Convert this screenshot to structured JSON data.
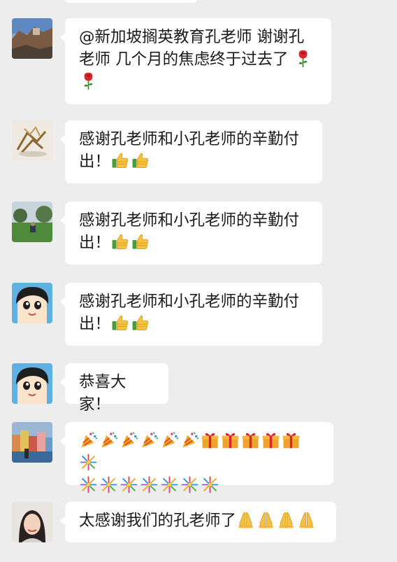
{
  "messages": [
    {
      "id": "m1",
      "avatar": "landscape-coast-avatar",
      "lines": [
        "@新加坡搁英教育孔老师  谢谢孔",
        "老师 几个月的焦虑终于过去了"
      ],
      "emojis_inline": [
        "rose-emoji"
      ],
      "emojis_line3": [
        "rose-emoji"
      ]
    },
    {
      "id": "m2",
      "avatar": "sculpture-avatar",
      "lines": [
        "感谢孔老师和小孔老师的辛勤付",
        "出！"
      ],
      "emojis": [
        "thumbs-up-emoji",
        "thumbs-up-emoji"
      ]
    },
    {
      "id": "m3",
      "avatar": "park-scene-avatar",
      "lines": [
        "感谢孔老师和小孔老师的辛勤付",
        "出！"
      ],
      "emojis": [
        "thumbs-up-emoji",
        "thumbs-up-emoji"
      ]
    },
    {
      "id": "m4",
      "avatar": "cartoon-face-avatar",
      "lines": [
        "感谢孔老师和小孔老师的辛勤付",
        "出！"
      ],
      "emojis": [
        "thumbs-up-emoji",
        "thumbs-up-emoji"
      ]
    },
    {
      "id": "m5",
      "avatar": "cartoon-face-avatar",
      "lines": [
        "恭喜大家！"
      ]
    },
    {
      "id": "m6",
      "avatar": "colorful-town-avatar",
      "emojis_line1": [
        "party-popper-emoji",
        "party-popper-emoji",
        "party-popper-emoji",
        "party-popper-emoji",
        "party-popper-emoji",
        "party-popper-emoji",
        "gift-emoji",
        "gift-emoji",
        "gift-emoji",
        "gift-emoji",
        "gift-emoji",
        "fireworks-emoji"
      ],
      "emojis_line2": [
        "fireworks-emoji",
        "fireworks-emoji",
        "fireworks-emoji",
        "fireworks-emoji",
        "fireworks-emoji",
        "fireworks-emoji",
        "fireworks-emoji"
      ]
    },
    {
      "id": "m7",
      "avatar": "woman-portrait-avatar",
      "lines": [
        "太感谢我们的孔老师了"
      ],
      "emojis": [
        "praying-hands-emoji",
        "praying-hands-emoji",
        "praying-hands-emoji",
        "praying-hands-emoji"
      ]
    }
  ],
  "colors": {
    "background": "#ededed",
    "bubble": "#ffffff",
    "text": "#1b1b1b"
  }
}
